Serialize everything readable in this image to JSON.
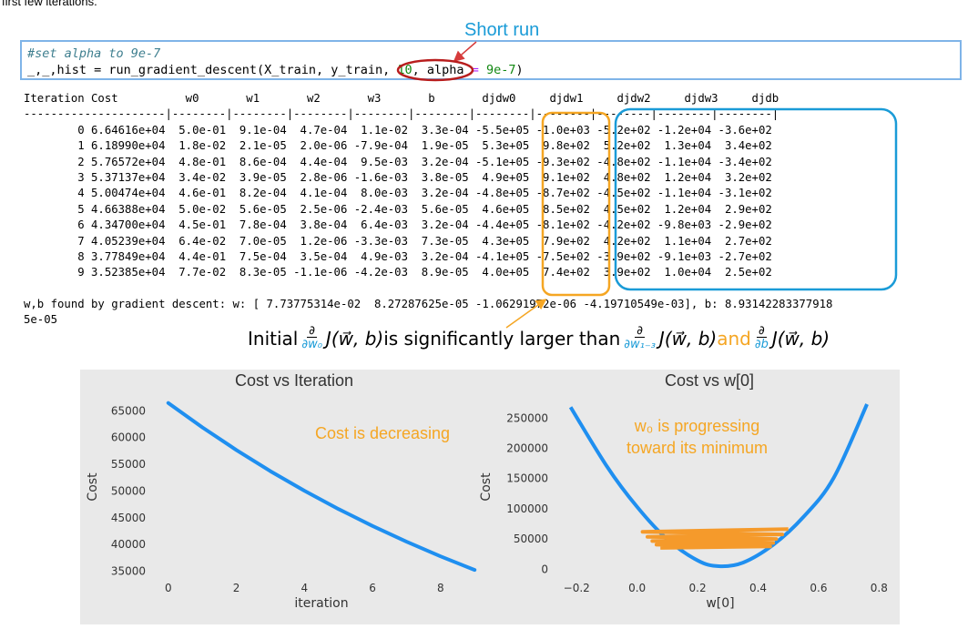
{
  "top_caption": "first few iterations.",
  "short_run_label": "Short run",
  "code": {
    "comment": "#set alpha to 9e-7",
    "call_prefix": "_,_,hist = run_gradient_descent(X_train, y_train, ",
    "iters": "10",
    "call_mid": ", alpha ",
    "eq": "=",
    "alpha_val": "9e-7",
    "call_end": ")"
  },
  "output": {
    "header": "Iteration Cost          w0       w1       w2       w3       b       djdw0     djdw1     djdw2     djdw3     djdb",
    "separator": "---------------------|--------|--------|--------|--------|--------|--------|--------|--------|--------|--------|",
    "rows": [
      "        0 6.64616e+04  5.0e-01  9.1e-04  4.7e-04  1.1e-02  3.3e-04 -5.5e+05 -1.0e+03 -5.2e+02 -1.2e+04 -3.6e+02",
      "        1 6.18990e+04  1.8e-02  2.1e-05  2.0e-06 -7.9e-04  1.9e-05  5.3e+05  9.8e+02  5.2e+02  1.3e+04  3.4e+02",
      "        2 5.76572e+04  4.8e-01  8.6e-04  4.4e-04  9.5e-03  3.2e-04 -5.1e+05 -9.3e+02 -4.8e+02 -1.1e+04 -3.4e+02",
      "        3 5.37137e+04  3.4e-02  3.9e-05  2.8e-06 -1.6e-03  3.8e-05  4.9e+05  9.1e+02  4.8e+02  1.2e+04  3.2e+02",
      "        4 5.00474e+04  4.6e-01  8.2e-04  4.1e-04  8.0e-03  3.2e-04 -4.8e+05 -8.7e+02 -4.5e+02 -1.1e+04 -3.1e+02",
      "        5 4.66388e+04  5.0e-02  5.6e-05  2.5e-06 -2.4e-03  5.6e-05  4.6e+05  8.5e+02  4.5e+02  1.2e+04  2.9e+02",
      "        6 4.34700e+04  4.5e-01  7.8e-04  3.8e-04  6.4e-03  3.2e-04 -4.4e+05 -8.1e+02 -4.2e+02 -9.8e+03 -2.9e+02",
      "        7 4.05239e+04  6.4e-02  7.0e-05  1.2e-06 -3.3e-03  7.3e-05  4.3e+05  7.9e+02  4.2e+02  1.1e+04  2.7e+02",
      "        8 3.77849e+04  4.4e-01  7.5e-04  3.5e-04  4.9e-03  3.2e-04 -4.1e+05 -7.5e+02 -3.9e+02 -9.1e+03 -2.7e+02",
      "        9 3.52385e+04  7.7e-02  8.3e-05 -1.1e-06 -4.2e-03  8.9e-05  4.0e+05  7.4e+02  3.9e+02  1.0e+04  2.5e+02"
    ],
    "result_line1": "w,b found by gradient descent: w: [ 7.73775314e-02  8.27287625e-05 -1.06291972e-06 -4.19710549e-03], b: 8.93142283377918",
    "result_line2": "5e-05"
  },
  "math": {
    "initial": "Initial ",
    "partial": "∂",
    "den1": "∂w₀",
    "jwb": "J(w⃗, b)",
    "middle": " is significantly larger than ",
    "den2": "∂w₁₋₃",
    "and": " and ",
    "den3": "∂b"
  },
  "charts": {
    "left_title": "Cost vs Iteration",
    "right_title": "Cost vs w[0]",
    "left_annot": "Cost is decreasing",
    "right_annot_1": "w₀ is  progressing",
    "right_annot_2": "toward its minimum",
    "colors": {
      "line": "#1f8ff0",
      "steps": "#f59a2b",
      "panel_bg": "#e9e9e9",
      "annot": "#f5a623"
    }
  },
  "chart_data": [
    {
      "type": "line",
      "title": "Cost vs Iteration",
      "xlabel": "iteration",
      "ylabel": "Cost",
      "xlim": [
        -0.45,
        9.45
      ],
      "ylim": [
        33900,
        67600
      ],
      "xticks": [
        0,
        2,
        4,
        6,
        8
      ],
      "yticks": [
        35000,
        40000,
        45000,
        50000,
        55000,
        60000,
        65000
      ],
      "x": [
        0,
        1,
        2,
        3,
        4,
        5,
        6,
        7,
        8,
        9
      ],
      "y": [
        66461.6,
        61899.0,
        57657.2,
        53713.7,
        50047.4,
        46638.8,
        43470.0,
        40523.9,
        37784.9,
        35238.5
      ],
      "grid": false
    },
    {
      "type": "line",
      "title": "Cost vs w[0]",
      "xlabel": "w[0]",
      "ylabel": "Cost",
      "xlim": [
        -0.27,
        0.82
      ],
      "ylim": [
        -13000,
        285000
      ],
      "xticks": [
        -0.2,
        0.0,
        0.2,
        0.4,
        0.6,
        0.8
      ],
      "yticks": [
        0,
        50000,
        100000,
        150000,
        200000,
        250000
      ],
      "curve": {
        "x": [
          -0.22,
          -0.1,
          0.0,
          0.1,
          0.2,
          0.27,
          0.35,
          0.45,
          0.55,
          0.65,
          0.76
        ],
        "y": [
          268000,
          170000,
          103000,
          49500,
          14500,
          5000,
          11000,
          40500,
          86500,
          151000,
          273000
        ]
      },
      "steps_w0": [
        0.5,
        0.018,
        0.48,
        0.034,
        0.46,
        0.05,
        0.45,
        0.064,
        0.44,
        0.077
      ],
      "steps_cost": [
        66461.6,
        61899.0,
        57657.2,
        53713.7,
        50047.4,
        46638.8,
        43470.0,
        40523.9,
        37784.9,
        35238.5
      ],
      "grid": false
    }
  ]
}
